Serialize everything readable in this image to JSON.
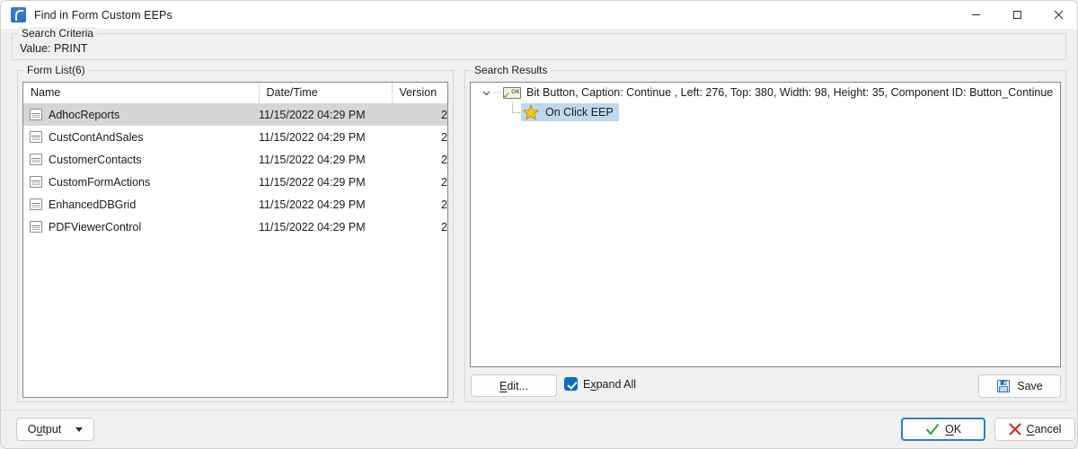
{
  "window": {
    "title": "Find in Form Custom EEPs",
    "icon": "app-icon",
    "controls": {
      "minimize": "minimize",
      "maximize": "maximize",
      "close": "close"
    }
  },
  "search_criteria": {
    "legend": "Search Criteria",
    "value_text": "Value: PRINT"
  },
  "form_list": {
    "legend": "Form List(6)",
    "columns": [
      "Name",
      "Date/Time",
      "Version"
    ],
    "rows": [
      {
        "name": "AdhocReports",
        "date": "11/15/2022 04:29 PM",
        "version": "2",
        "selected": true
      },
      {
        "name": "CustContAndSales",
        "date": "11/15/2022 04:29 PM",
        "version": "2",
        "selected": false
      },
      {
        "name": "CustomerContacts",
        "date": "11/15/2022 04:29 PM",
        "version": "2",
        "selected": false
      },
      {
        "name": "CustomFormActions",
        "date": "11/15/2022 04:29 PM",
        "version": "2",
        "selected": false
      },
      {
        "name": "EnhancedDBGrid",
        "date": "11/15/2022 04:29 PM",
        "version": "2",
        "selected": false
      },
      {
        "name": "PDFViewerControl",
        "date": "11/15/2022 04:29 PM",
        "version": "2",
        "selected": false
      }
    ]
  },
  "search_results": {
    "legend": "Search Results",
    "tree": {
      "root": {
        "label": "Bit Button, Caption: Continue , Left: 276, Top: 380, Width: 98, Height: 35, Component ID: Button_Continue",
        "icon": "ok-button-icon",
        "expanded": true,
        "chevron": "chevron-down-icon"
      },
      "children": [
        {
          "label": "On Click EEP",
          "icon": "star-icon",
          "selected": true
        }
      ]
    },
    "footer": {
      "edit_label": "Edit...",
      "edit_accel": "E",
      "expand_all_label": "Expand All",
      "expand_all_checked": true,
      "save_label": "Save"
    }
  },
  "bottom_bar": {
    "output_label": "Output",
    "ok_label": "OK",
    "cancel_label": "Cancel"
  },
  "colors": {
    "accent_blue": "#0f6cbd",
    "focus_blue": "#2b7bd4",
    "selection_gray": "#d6d6d6",
    "selection_blue": "#bdd9ef",
    "ok_green": "#1e9e1e",
    "cancel_red": "#d42a2a",
    "star_gold": "#f5c518"
  }
}
